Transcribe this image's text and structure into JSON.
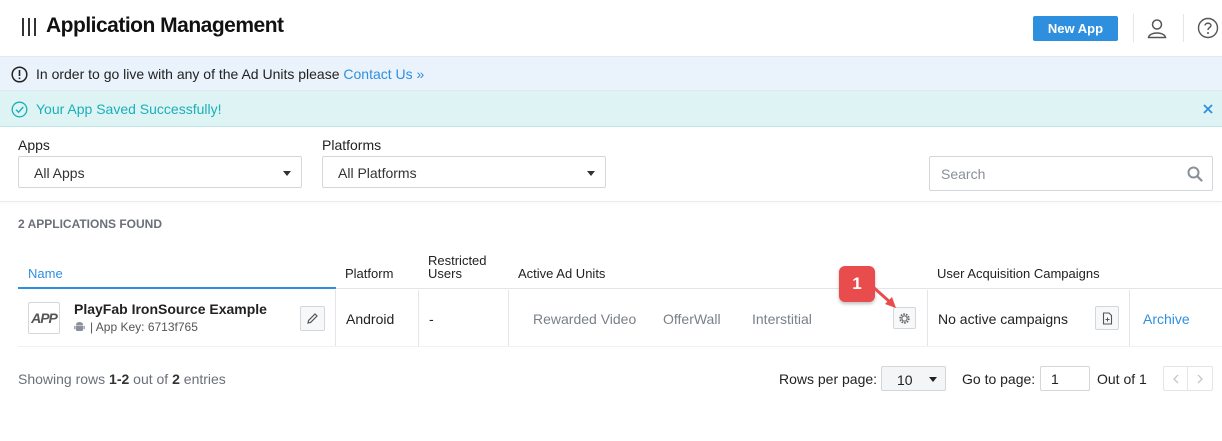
{
  "header": {
    "title": "Application Management",
    "new_app_label": "New App"
  },
  "banners": {
    "info_text": "In order to go live with any of the Ad Units please",
    "info_link": "Contact Us »",
    "success_text": "Your App Saved Successfully!"
  },
  "filters": {
    "apps_label": "Apps",
    "apps_value": "All Apps",
    "platforms_label": "Platforms",
    "platforms_value": "All Platforms",
    "search_placeholder": "Search"
  },
  "results": {
    "count_text": "2 APPLICATIONS FOUND"
  },
  "table": {
    "headers": {
      "name": "Name",
      "platform": "Platform",
      "restricted_line1": "Restricted",
      "restricted_line2": "Users",
      "active_ad_units": "Active Ad Units",
      "ua_campaigns": "User Acquisition Campaigns"
    },
    "rows": [
      {
        "logo_text": "APP",
        "app_name": "PlayFab IronSource Example",
        "app_key_text": "| App Key: 6713f765",
        "platform": "Android",
        "restricted_users": "-",
        "ad_units": [
          "Rewarded Video",
          "OfferWall",
          "Interstitial"
        ],
        "campaigns": "No active campaigns",
        "action": "Archive"
      }
    ]
  },
  "annotation": {
    "step": "1"
  },
  "footer": {
    "showing_prefix": "Showing rows",
    "showing_range": "1-2",
    "showing_mid": "out of",
    "showing_total": "2",
    "showing_suffix": "entries",
    "rows_per_page_label": "Rows per page:",
    "rows_per_page_value": "10",
    "go_to_page_label": "Go to page:",
    "go_to_page_value": "1",
    "out_of_text": "Out of 1"
  },
  "colors": {
    "primary": "#2f8fdf",
    "success_text": "#1ab0b8",
    "success_bg": "#ddf3f4",
    "info_bg": "#eaf3fb",
    "annotation": "#e84c4c"
  }
}
